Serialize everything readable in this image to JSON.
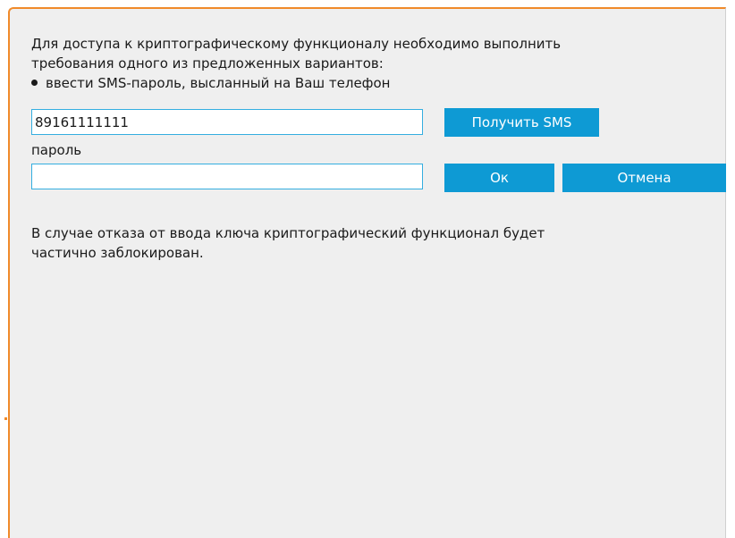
{
  "dialog": {
    "intro_line1": "Для доступа к криптографическому функционалу необходимо выполнить",
    "intro_line2": "требования одного из предложенных вариантов:",
    "option_sms": "ввести SMS-пароль, высланный на Ваш телефон",
    "phone_value": "89161111111",
    "get_sms_label": "Получить SMS",
    "password_label": "пароль",
    "password_value": "",
    "ok_label": "Ок",
    "cancel_label": "Отмена",
    "warning_line1": "В случае отказа от ввода ключа криптографический функционал будет",
    "warning_line2": "частично заблокирован."
  },
  "colors": {
    "accent_border": "#f08a2a",
    "button_bg": "#0e9ad4",
    "input_border": "#34aee0",
    "panel_bg": "#efefef"
  }
}
